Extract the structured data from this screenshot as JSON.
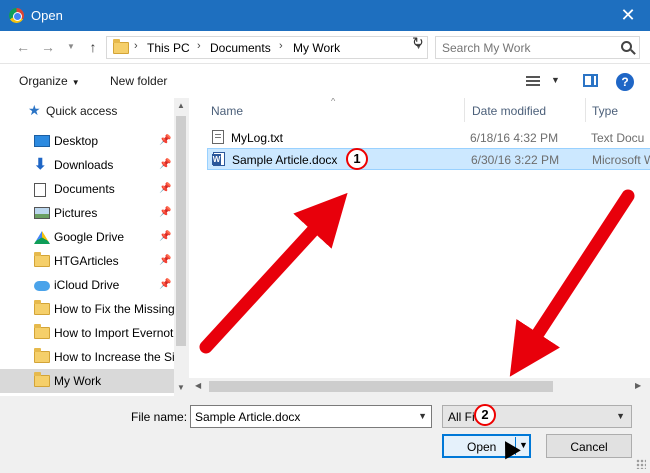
{
  "window": {
    "title": "Open",
    "close_glyph": "✕",
    "app_icon": "chrome-icon"
  },
  "address": {
    "breadcrumbs": [
      "This PC",
      "Documents",
      "My Work"
    ],
    "separator": "›",
    "search_placeholder": "Search My Work"
  },
  "toolbar": {
    "organize": "Organize",
    "new_folder": "New folder",
    "help": "?"
  },
  "nav": {
    "quick_access": "Quick access",
    "items": [
      {
        "label": "Desktop",
        "icon": "desktop-icon",
        "pinned": true
      },
      {
        "label": "Downloads",
        "icon": "download-icon",
        "pinned": true
      },
      {
        "label": "Documents",
        "icon": "documents-icon",
        "pinned": true
      },
      {
        "label": "Pictures",
        "icon": "pictures-icon",
        "pinned": true
      },
      {
        "label": "Google Drive",
        "icon": "google-drive-icon",
        "pinned": true
      },
      {
        "label": "HTGArticles",
        "icon": "folder-icon",
        "pinned": true
      },
      {
        "label": "iCloud Drive",
        "icon": "icloud-icon",
        "pinned": true
      },
      {
        "label": "How to Fix the Missing",
        "icon": "folder-icon",
        "pinned": false
      },
      {
        "label": "How to Import Evernot",
        "icon": "folder-icon",
        "pinned": false
      },
      {
        "label": "How to Increase the Siz",
        "icon": "folder-icon",
        "pinned": false
      },
      {
        "label": "My Work",
        "icon": "folder-icon",
        "pinned": false,
        "selected": true
      }
    ]
  },
  "files": {
    "columns": [
      "Name",
      "Date modified",
      "Type"
    ],
    "rows": [
      {
        "name": "MyLog.txt",
        "date": "6/18/16 4:32 PM",
        "type": "Text Docu"
      },
      {
        "name": "Sample Article.docx",
        "date": "6/30/16 3:22 PM",
        "type": "Microsoft W",
        "selected": true
      }
    ]
  },
  "footer": {
    "filename_label": "File name:",
    "filename_value": "Sample Article.docx",
    "filter_value": "All Fi",
    "open_label": "Open",
    "cancel_label": "Cancel"
  },
  "annotations": {
    "badge1": "1",
    "badge2": "2"
  },
  "colors": {
    "titlebar": "#1e6fbf",
    "selection": "#cce8ff",
    "arrow": "#e8000b",
    "accent": "#0078d7"
  }
}
